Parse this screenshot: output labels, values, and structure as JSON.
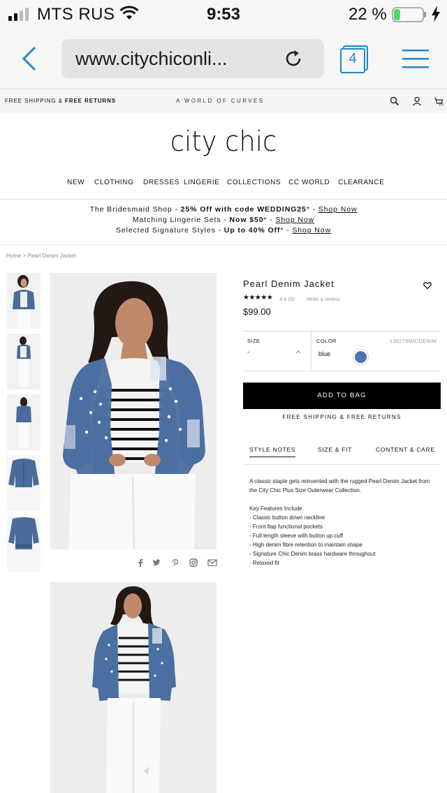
{
  "status_bar": {
    "carrier": "MTS RUS",
    "time": "9:53",
    "battery_percent": "22 %",
    "battery_level": 0.22,
    "battery_color": "#4cd964"
  },
  "browser": {
    "url": "www.citychiconli...",
    "tab_count": "4",
    "accent_color": "#1e88c5"
  },
  "utility_bar": {
    "shipping_prefix": "FREE SHIPPING & ",
    "shipping_bold": "FREE RETURNS",
    "tagline": "A WORLD OF CURVES",
    "cart_count": "(0)"
  },
  "logo": "city chic",
  "nav": [
    "NEW",
    "CLOTHING",
    "DRESSES",
    "LINGERIE",
    "COLLECTIONS",
    "CC WORLD",
    "CLEARANCE"
  ],
  "promo": [
    {
      "text": "The Bridesmaid Shop - ",
      "bold": "25% Off with code WEDDING25",
      "suffix": "* - ",
      "link": "Shop Now"
    },
    {
      "text": "Matching Lingerie Sets - ",
      "bold": "Now $50",
      "suffix": "* - ",
      "link": "Shop Now"
    },
    {
      "text": "Selected Signature Styles - ",
      "bold": "Up to 40% Off",
      "suffix": "* - ",
      "link": "Shop Now"
    }
  ],
  "breadcrumb": "Home  >  Pearl Denim Jacket",
  "product": {
    "name": "Pearl Denim Jacket",
    "stars": "★★★★★",
    "rating": "4.8  (5)",
    "review_link": "Write a review",
    "price": "$99.00",
    "size_label": "SIZE",
    "size_value": "-",
    "color_label": "COLOR",
    "sku": "138276MIDDENIM",
    "color_value": "blue",
    "swatch_color": "#4a74ae",
    "add_to_bag": "ADD TO BAG",
    "shipping_note": "FREE SHIPPING & FREE RETURNS"
  },
  "tabs": [
    "STYLE NOTES",
    "SIZE & FIT",
    "CONTENT & CARE"
  ],
  "description": {
    "intro": "A classic staple gets reinvented with the rugged Pearl Denim Jacket from the City Chic Plus Size Outerwear Collection.",
    "features_title": "Key Features Include:",
    "features": [
      "- Classic button down neckline",
      "- Front flap functional pockets",
      "- Full length sleeve with button up cuff",
      "- High denim fibre retention to maintain shape",
      "- Signature Chic Denim brass hardware throughout",
      "- Relaxed fit"
    ]
  }
}
